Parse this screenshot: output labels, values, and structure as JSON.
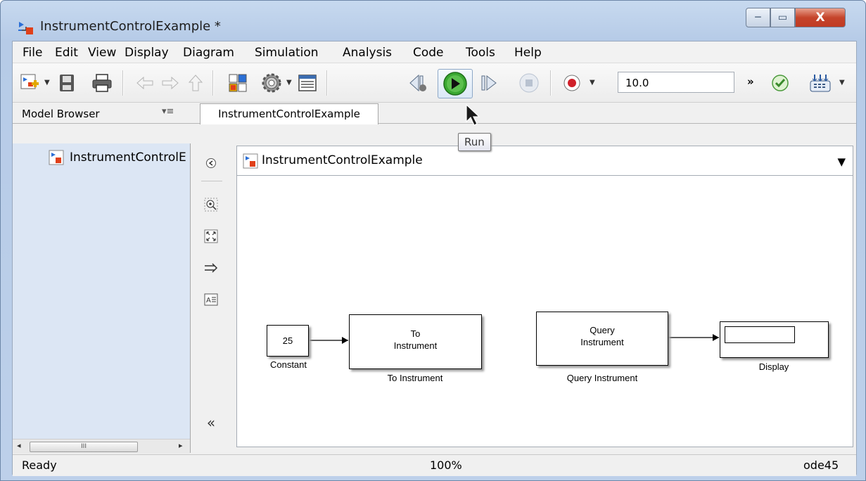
{
  "window": {
    "title": "InstrumentControlExample *",
    "controls": {
      "minimize": "─",
      "maximize": "▭",
      "close": "X"
    }
  },
  "menu": [
    "File",
    "Edit",
    "View",
    "Display",
    "Diagram",
    "Simulation",
    "Analysis",
    "Code",
    "Tools",
    "Help"
  ],
  "toolbar": {
    "stop_time": "10.0",
    "more_label": "»",
    "run_tooltip": "Run"
  },
  "model_browser": {
    "label": "Model Browser",
    "menu_glyph": "▾≡",
    "tree_item": "InstrumentControlExample",
    "scroll_thumb": "III",
    "scroll_left": "◂",
    "scroll_right": "▸"
  },
  "tab": {
    "label": "InstrumentControlExample"
  },
  "address_bar": {
    "path": "InstrumentControlExample",
    "dropdown": "▼"
  },
  "side_tools": {
    "collapse": "«"
  },
  "diagram": {
    "blocks": [
      {
        "name": "Constant",
        "content": "25",
        "label": "Constant"
      },
      {
        "name": "To Instrument",
        "content_line1": "To",
        "content_line2": "Instrument",
        "label": "To Instrument"
      },
      {
        "name": "Query Instrument",
        "content_line1": "Query",
        "content_line2": "Instrument",
        "label": "Query Instrument"
      },
      {
        "name": "Display",
        "content": "",
        "label": "Display"
      }
    ]
  },
  "status": {
    "left": "Ready",
    "zoom": "100%",
    "solver": "ode45"
  },
  "colors": {
    "run_green": "#3aa832",
    "title_bar": "#bdd0ea",
    "tree_bg": "#dce6f4",
    "close_red": "#c5442b"
  }
}
